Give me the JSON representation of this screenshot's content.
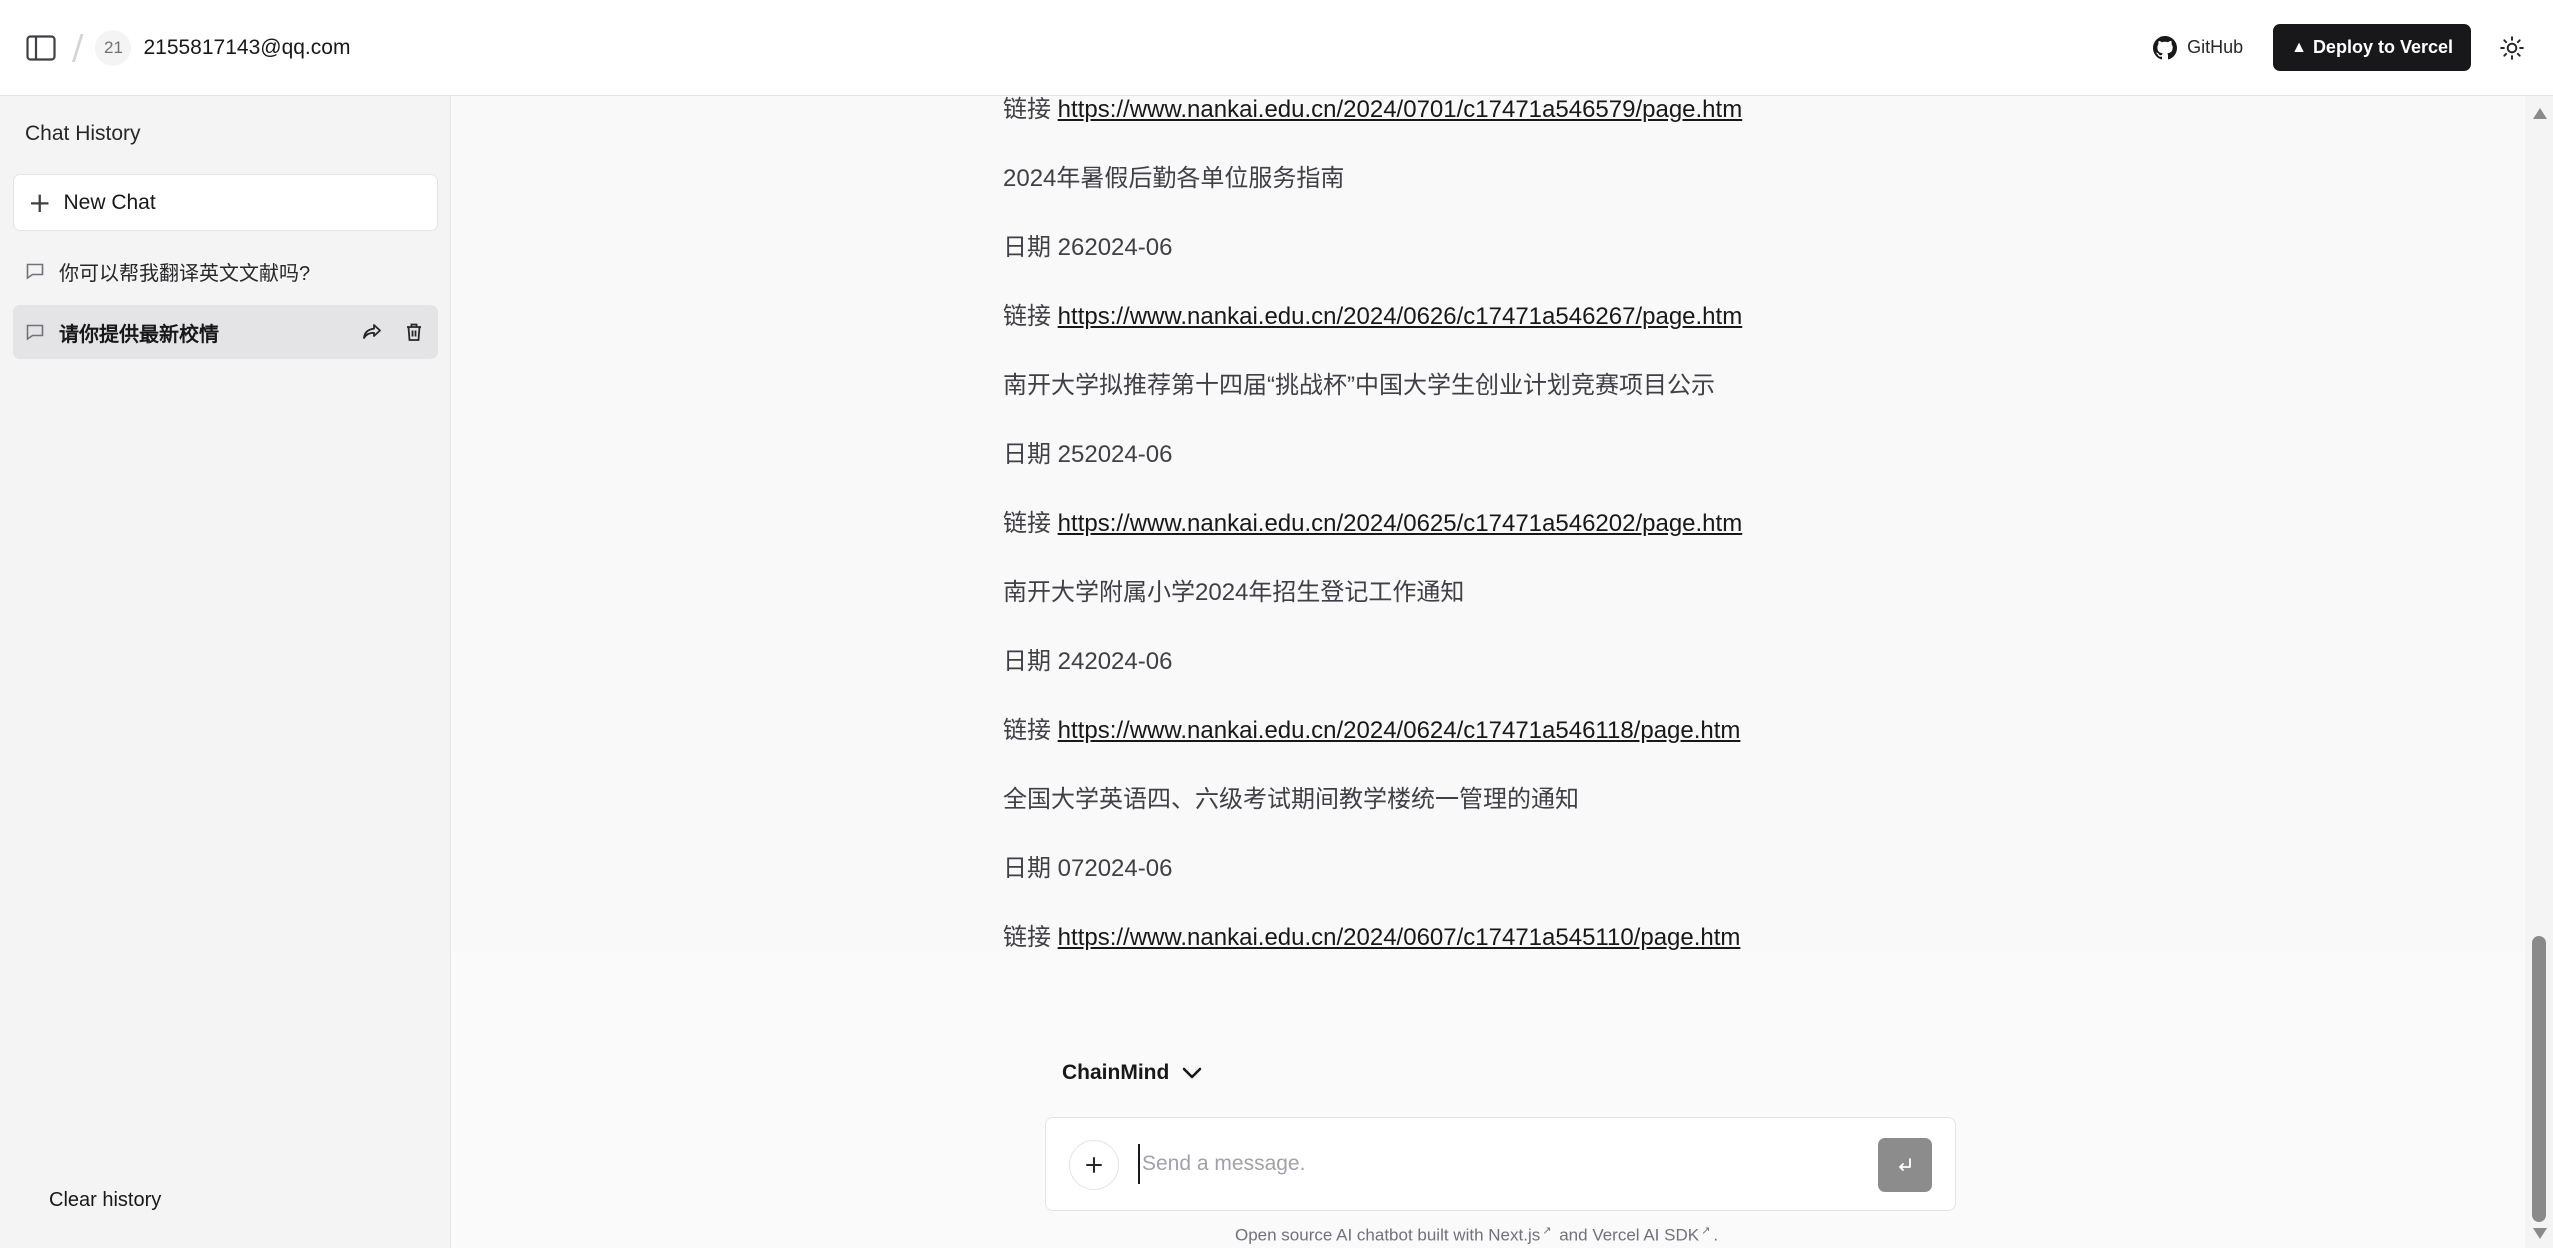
{
  "header": {
    "avatar_text": "21",
    "user_email": "2155817143@qq.com",
    "github_label": "GitHub",
    "deploy_label": "Deploy to Vercel"
  },
  "sidebar": {
    "title": "Chat History",
    "new_chat_label": "New Chat",
    "chats": [
      {
        "title": "你可以帮我翻译英文文献吗?",
        "active": false
      },
      {
        "title": "请你提供最新校情",
        "active": true
      }
    ],
    "clear_history_label": "Clear history"
  },
  "messages": [
    {
      "prefix": "链接 ",
      "link": "https://www.nankai.edu.cn/2024/0701/c17471a546579/page.htm"
    },
    {
      "text": "2024年暑假后勤各单位服务指南"
    },
    {
      "text": "日期 262024-06"
    },
    {
      "prefix": "链接 ",
      "link": "https://www.nankai.edu.cn/2024/0626/c17471a546267/page.htm"
    },
    {
      "text": "南开大学拟推荐第十四届“挑战杯”中国大学生创业计划竞赛项目公示"
    },
    {
      "text": "日期 252024-06"
    },
    {
      "prefix": "链接 ",
      "link": "https://www.nankai.edu.cn/2024/0625/c17471a546202/page.htm"
    },
    {
      "text": "南开大学附属小学2024年招生登记工作通知"
    },
    {
      "text": "日期 242024-06"
    },
    {
      "prefix": "链接 ",
      "link": "https://www.nankai.edu.cn/2024/0624/c17471a546118/page.htm"
    },
    {
      "text": "全国大学英语四、六级考试期间教学楼统一管理的通知"
    },
    {
      "text": "日期 072024-06"
    },
    {
      "prefix": "链接 ",
      "link": "https://www.nankai.edu.cn/2024/0607/c17471a545110/page.htm"
    }
  ],
  "composer": {
    "model_name": "ChainMind",
    "placeholder": "Send a message.",
    "value": ""
  },
  "footer": {
    "part1": "Open source AI chatbot built with",
    "link1": "Next.js",
    "part2": "and",
    "link2": "Vercel AI SDK",
    "part3": "."
  },
  "colors": {
    "deploy_bg": "#18181b",
    "active_chat_bg": "#e4e4e7",
    "send_btn_bg": "#8c8c8c"
  }
}
